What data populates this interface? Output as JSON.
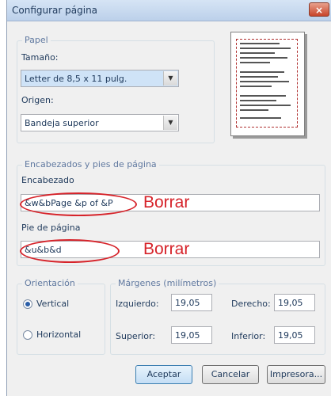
{
  "window": {
    "title": "Configurar página",
    "close_glyph": "×"
  },
  "paper": {
    "legend": "Papel",
    "size_label": "Tamaño:",
    "size_value": "Letter de 8,5 x 11 pulg.",
    "source_label": "Origen:",
    "source_value": "Bandeja superior"
  },
  "headers_footers": {
    "legend": "Encabezados y pies de página",
    "header_label": "Encabezado",
    "header_value": "&w&bPage &p of &P",
    "footer_label": "Pie de página",
    "footer_value": "&u&b&d",
    "annotation": "Borrar"
  },
  "orientation": {
    "legend": "Orientación",
    "vertical_label": "Vertical",
    "horizontal_label": "Horizontal",
    "selected": "vertical"
  },
  "margins": {
    "legend": "Márgenes (milímetros)",
    "left_label": "Izquierdo:",
    "left_value": "19,05",
    "right_label": "Derecho:",
    "right_value": "19,05",
    "top_label": "Superior:",
    "top_value": "19,05",
    "bottom_label": "Inferior:",
    "bottom_value": "19,05"
  },
  "buttons": {
    "ok": "Aceptar",
    "cancel": "Cancelar",
    "printer": "Impresora..."
  },
  "icons": {
    "dropdown": "chevron-down-icon",
    "close": "close-icon"
  },
  "colors": {
    "annotation_red": "#d6232a",
    "legend_blue": "#6079a0",
    "selection_blue": "#cfe3f7"
  }
}
